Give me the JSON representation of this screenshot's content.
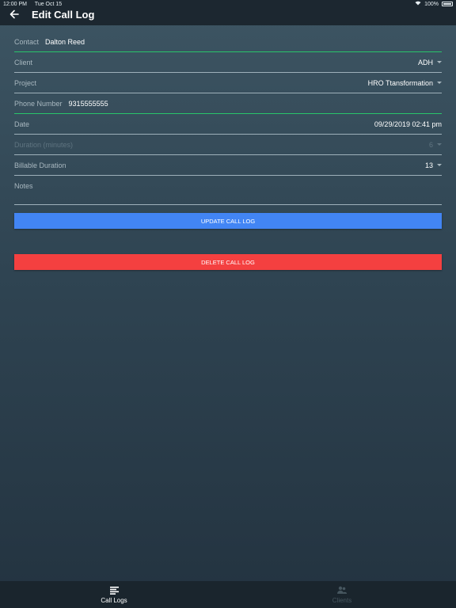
{
  "status_bar": {
    "time": "12:00 PM",
    "date": "Tue Oct 15",
    "battery": "100%"
  },
  "header": {
    "title": "Edit Call Log",
    "back_icon": "arrow-left-icon"
  },
  "form": {
    "contact": {
      "label": "Contact",
      "value": "Dalton Reed"
    },
    "client": {
      "label": "Client",
      "value": "ADH"
    },
    "project": {
      "label": "Project",
      "value": "HRO Ttansformation"
    },
    "phone": {
      "label": "Phone Number",
      "value": "9315555555"
    },
    "date": {
      "label": "Date",
      "value": "09/29/2019 02:41 pm"
    },
    "duration": {
      "label": "Duration (minutes)",
      "value": "6"
    },
    "billable_duration": {
      "label": "Billable Duration",
      "value": "13"
    },
    "notes": {
      "label": "Notes",
      "value": ""
    }
  },
  "buttons": {
    "update": "UPDATE CALL LOG",
    "delete": "DELETE CALL LOG"
  },
  "tabs": [
    {
      "label": "Call Logs",
      "icon": "list-icon",
      "active": true
    },
    {
      "label": "Clients",
      "icon": "clients-icon",
      "active": false
    }
  ],
  "colors": {
    "accent_green": "#29c46a",
    "update_button": "#4285f4",
    "delete_button": "#f44040",
    "header_bg": "#1c2730"
  }
}
